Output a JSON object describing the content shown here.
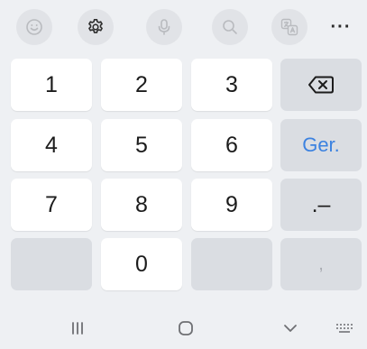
{
  "toolbar": {
    "items": [
      {
        "icon": "emoji-icon"
      },
      {
        "icon": "settings-icon"
      },
      {
        "icon": "microphone-icon"
      },
      {
        "icon": "search-icon"
      },
      {
        "icon": "translate-icon"
      }
    ],
    "more_label": "···"
  },
  "keys": {
    "k1": "1",
    "k2": "2",
    "k3": "3",
    "k4": "4",
    "k5": "5",
    "k6": "6",
    "k7": "7",
    "k8": "8",
    "k9": "9",
    "k0": "0",
    "go": "Ger.",
    "dot_dash": ".–",
    "comma": ","
  },
  "navbar": {
    "icons": [
      "recents-icon",
      "home-icon",
      "back-chevron-icon",
      "keyboard-icon"
    ]
  },
  "colors": {
    "background": "#eef0f3",
    "key": "#ffffff",
    "function_key": "#dadde2",
    "accent": "#3c82e0"
  }
}
